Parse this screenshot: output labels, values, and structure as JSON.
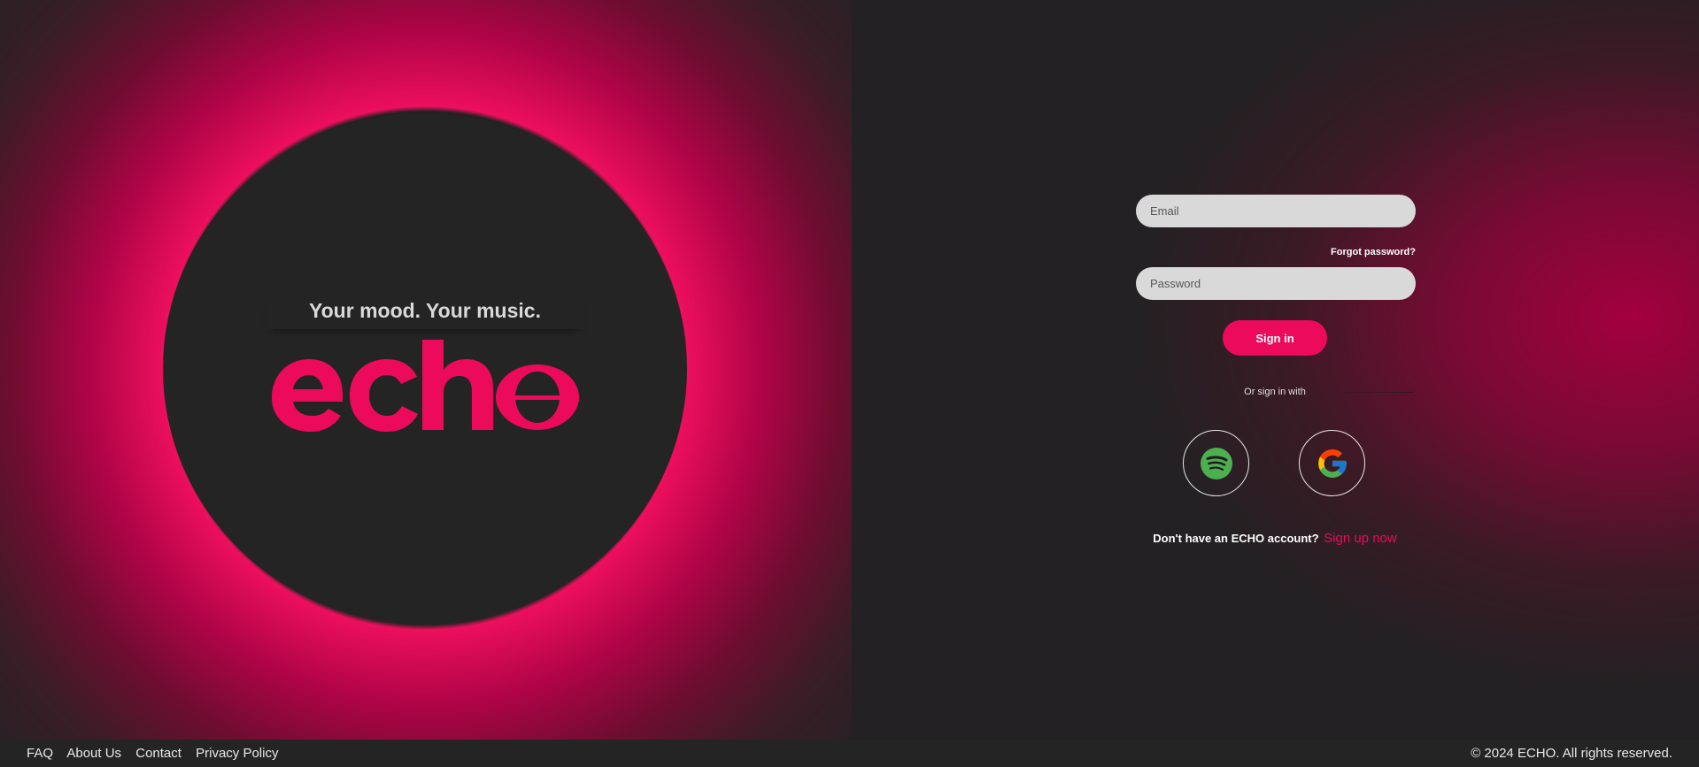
{
  "hero": {
    "tagline": "Your mood. Your music.",
    "logo_text": "echo"
  },
  "login": {
    "email_placeholder": "Email",
    "password_placeholder": "Password",
    "forgot_label": "Forgot password?",
    "signin_label": "Sign in",
    "or_label": "Or sign in with",
    "social": [
      {
        "name": "spotify",
        "icon": "spotify-icon"
      },
      {
        "name": "google",
        "icon": "google-icon"
      }
    ],
    "signup_prompt": "Don't have an ECHO account?",
    "signup_link": "Sign up now"
  },
  "footer": {
    "links": [
      "FAQ",
      "About Us",
      "Contact",
      "Privacy Policy"
    ],
    "copyright": "© 2024 ECHO. All rights reserved."
  },
  "colors": {
    "accent": "#ec0a5a",
    "background": "#222222",
    "input_bg": "#d9d9d9",
    "spotify_green": "#1db954"
  }
}
